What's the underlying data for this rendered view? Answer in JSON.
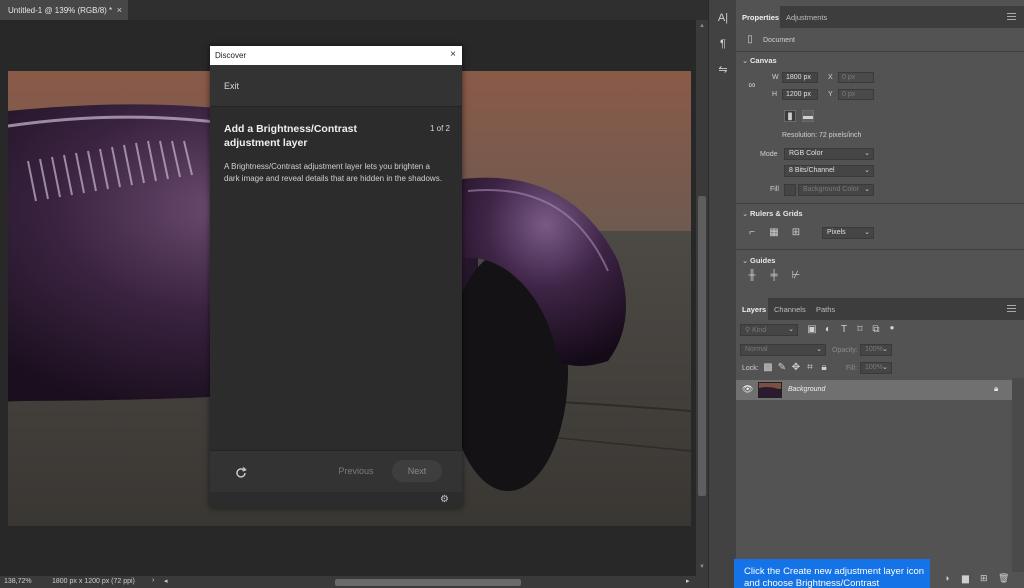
{
  "document": {
    "tab_title": "Untitled-1 @ 139% (RGB/8) *",
    "tab_close": "×"
  },
  "status": {
    "zoom": "138,72%",
    "info": "1800 px x 1200 px (72 ppi)",
    "arrow": "›"
  },
  "discover": {
    "header": "Discover",
    "close": "×",
    "exit_label": "Exit",
    "title": "Add a Brightness/Contrast adjustment layer",
    "step": "1 of 2",
    "body": "A Brightness/Contrast adjustment layer lets you brighten a dark image and reveal details that are hidden in the shadows.",
    "previous_label": "Previous",
    "next_label": "Next"
  },
  "properties": {
    "tab_properties": "Properties",
    "tab_adjustments": "Adjustments",
    "document_label": "Document",
    "canvas_section": "Canvas",
    "w_label": "W",
    "w_value": "1800 px",
    "h_label": "H",
    "h_value": "1200 px",
    "x_label": "X",
    "x_value": "0 px",
    "y_label": "Y",
    "y_value": "0 px",
    "resolution": "Resolution: 72 pixels/inch",
    "mode_label": "Mode",
    "mode_value": "RGB Color",
    "bits_value": "8 Bits/Channel",
    "fill_label": "Fill",
    "fill_value": "Background Color",
    "rulers_section": "Rulers & Grids",
    "units_value": "Pixels",
    "guides_section": "Guides"
  },
  "layers": {
    "tab_layers": "Layers",
    "tab_channels": "Channels",
    "tab_paths": "Paths",
    "filter_kind": "Kind",
    "blend_mode": "Normal",
    "opacity_label": "Opacity:",
    "opacity_value": "100%",
    "lock_label": "Lock:",
    "fill_label": "Fill:",
    "fill_value": "100%",
    "layer_name": "Background"
  },
  "tooltip": {
    "text": "Click the Create new adjustment layer icon and choose Brightness/Contrast"
  },
  "colors": {
    "accent": "#1473e6",
    "panel_bg": "#535353",
    "canvas_bg": "#282828"
  }
}
